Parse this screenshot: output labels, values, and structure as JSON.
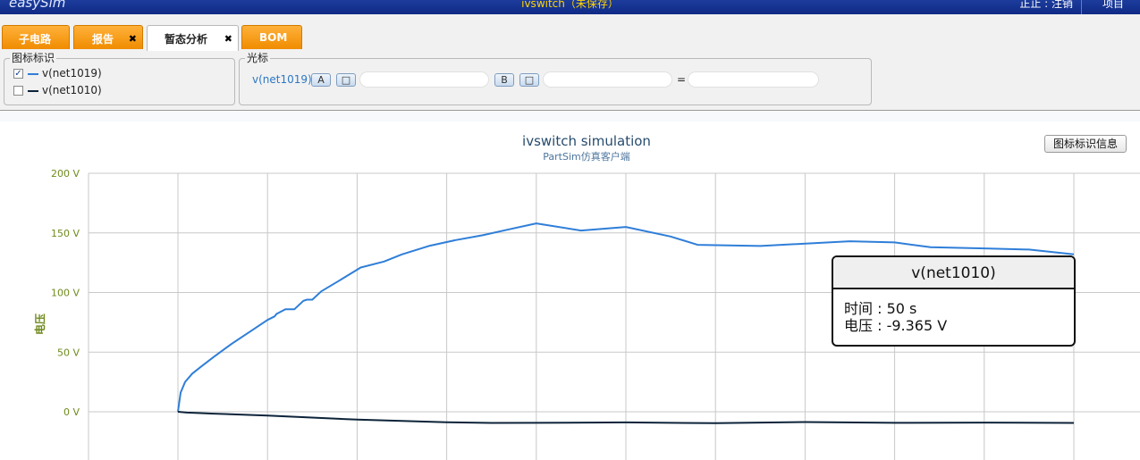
{
  "topbar": {
    "logo": "easySim",
    "title": "ivswitch（未保存）",
    "user_links": "正止 : 注销",
    "project_button": "项目"
  },
  "tabs": [
    {
      "label": "子电路",
      "closable": false,
      "active": false
    },
    {
      "label": "报告",
      "closable": true,
      "active": false
    },
    {
      "label": "暂态分析",
      "closable": true,
      "active": true
    },
    {
      "label": "BOM",
      "closable": false,
      "active": false
    }
  ],
  "close_glyph": "✖",
  "legend_panel": {
    "title": "图标标识",
    "items": [
      {
        "label": "v(net1019)",
        "checked": true,
        "color": "#2f7ed8"
      },
      {
        "label": "v(net1010)",
        "checked": false,
        "color": "#0d233a"
      }
    ]
  },
  "cursor_panel": {
    "title": "光标",
    "series": "v(net1019)",
    "button_a": "A",
    "button_b": "B",
    "equals": "="
  },
  "chart_info_button": "图标标识信息",
  "chart_data": {
    "type": "line",
    "title": "ivswitch simulation",
    "subtitle": "PartSim仿真客户端",
    "ylabel": "电压",
    "y_ticks": [
      "200 V",
      "150 V",
      "100 V",
      "50 V",
      "0 V"
    ],
    "ylim": [
      -40,
      200
    ],
    "xlim": [
      0,
      50
    ],
    "grid": true,
    "series": [
      {
        "name": "v(net1019)",
        "color": "#2f7ed8",
        "x": [
          0,
          0.15,
          0.4,
          0.8,
          1.3,
          2,
          3,
          4,
          5,
          5.4,
          5.5,
          6,
          6.5,
          7,
          7.2,
          7.5,
          8,
          9,
          10.2,
          11.5,
          12.5,
          14,
          15.5,
          17,
          18.5,
          20,
          22.5,
          25,
          27.5,
          29,
          32.5,
          37.5,
          40,
          42,
          45,
          47.5,
          50
        ],
        "y": [
          0,
          16,
          25,
          32,
          38,
          46,
          57,
          67,
          77,
          80,
          82,
          86,
          86,
          93,
          94,
          94,
          101,
          110,
          121,
          126,
          132,
          139,
          144,
          148,
          153,
          158,
          152,
          155,
          147,
          140,
          139,
          143,
          142,
          138,
          137,
          136,
          132
        ]
      },
      {
        "name": "v(net1010)",
        "color": "#0d233a",
        "x": [
          0,
          0.5,
          2,
          5,
          10,
          15,
          17.5,
          20,
          25,
          27.5,
          30,
          35,
          40,
          45,
          50
        ],
        "y": [
          0,
          -0.7,
          -1.6,
          -3.2,
          -6.6,
          -8.8,
          -9.4,
          -9.3,
          -8.9,
          -9.3,
          -9.6,
          -8.6,
          -9.3,
          -9.1,
          -9.365
        ]
      }
    ]
  },
  "tooltip": {
    "title": "v(net1010)",
    "time_line": "时间 : 50 s",
    "voltage_line": "电压 : -9.365 V"
  }
}
